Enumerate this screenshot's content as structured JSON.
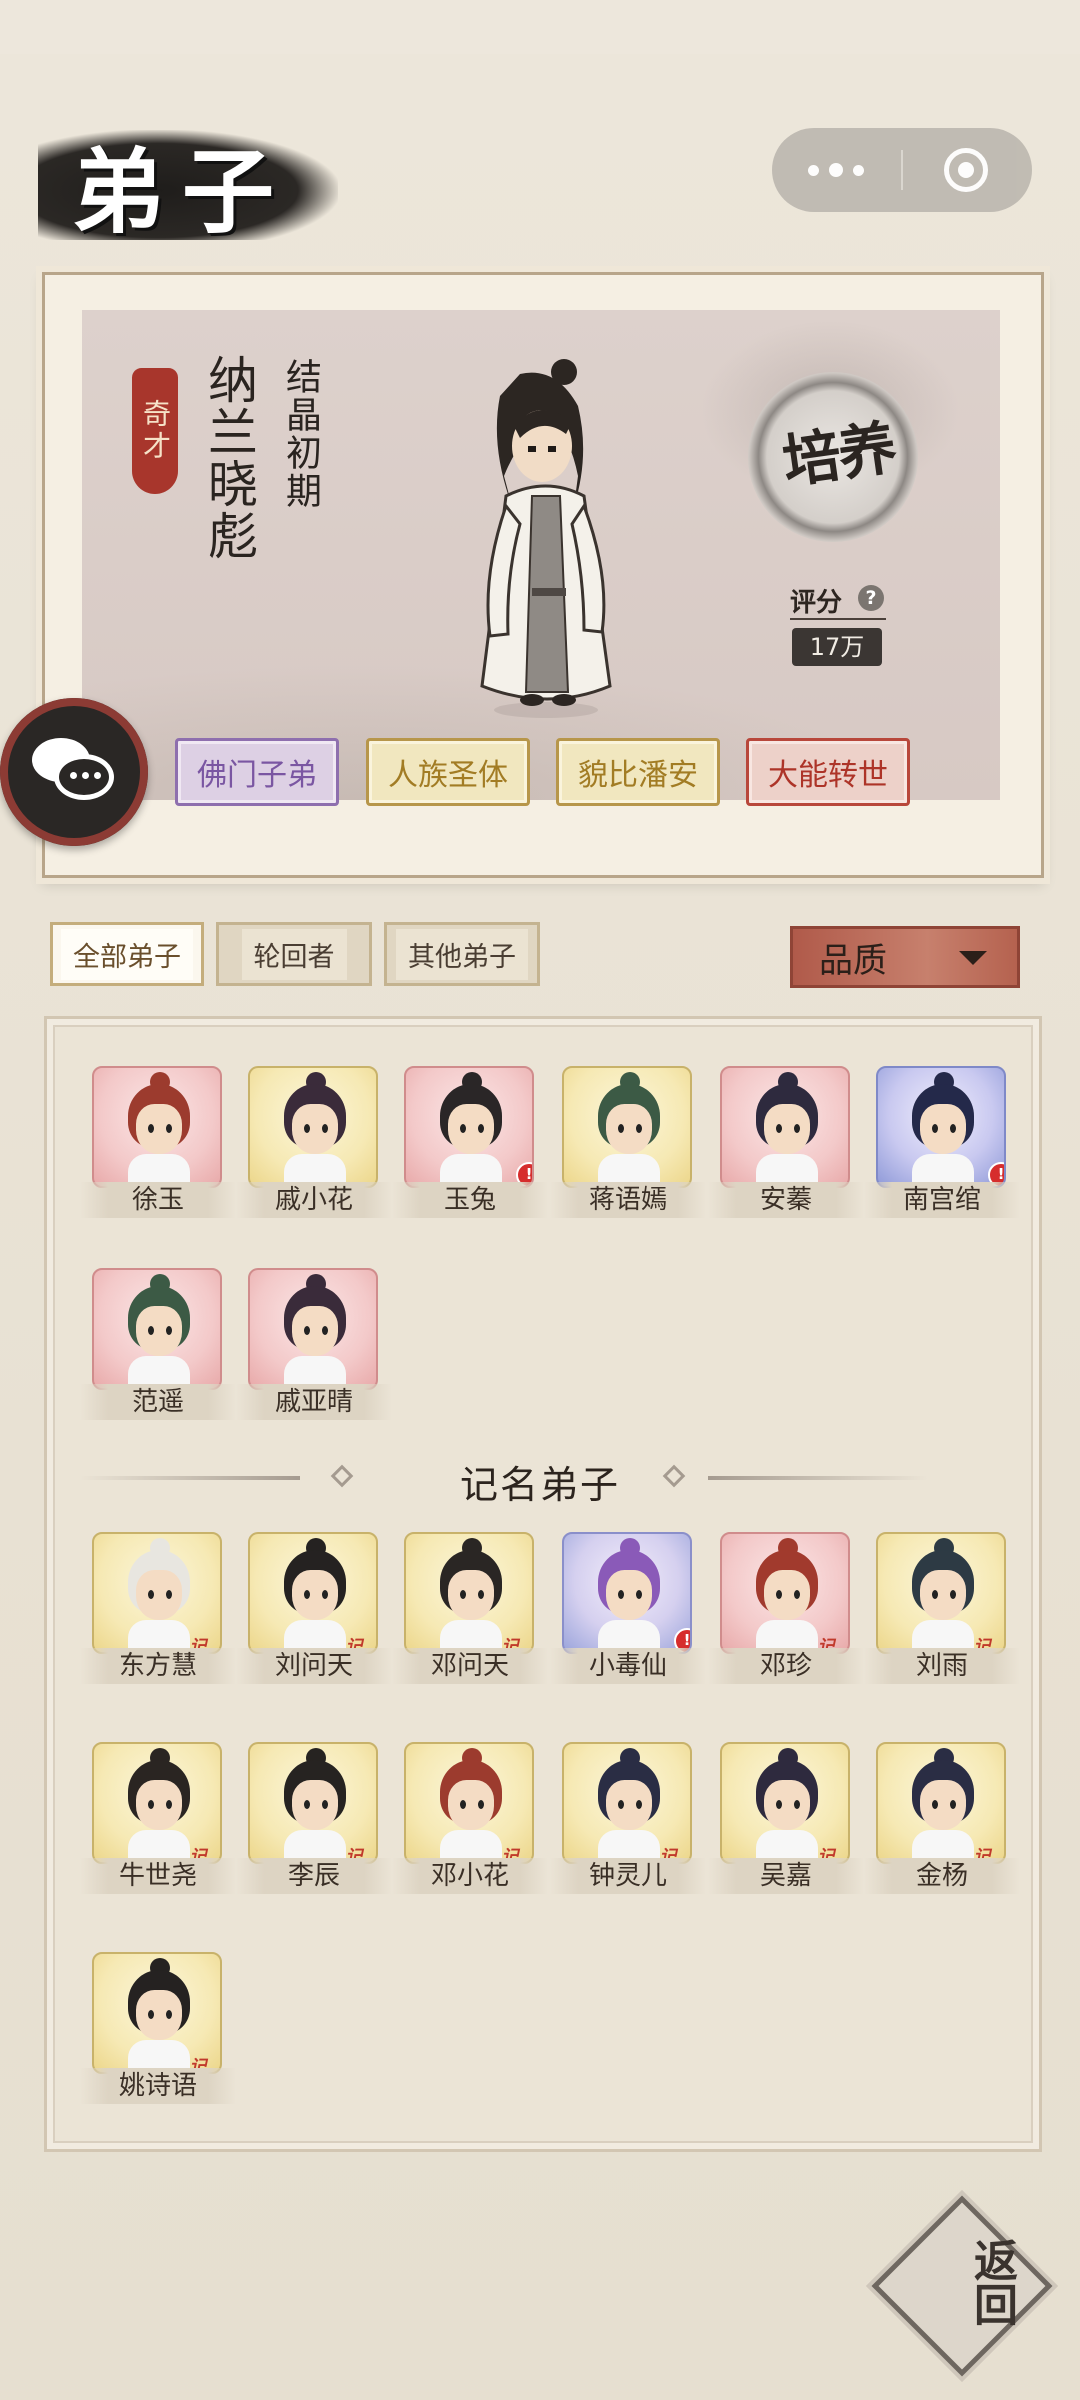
{
  "header": {
    "title": "弟子"
  },
  "hero": {
    "rank_tag": "奇才",
    "name": "纳兰晓彪",
    "realm": "结晶初期",
    "cultivate_label": "培养",
    "score_label": "评分",
    "score_help": "?",
    "score_value": "17万",
    "traits": [
      "佛门子弟",
      "人族圣体",
      "貌比潘安",
      "大能转世"
    ]
  },
  "filters": {
    "all": "全部弟子",
    "reincarnated": "轮回者",
    "others": "其他弟子",
    "quality": "品质"
  },
  "disciples": [
    {
      "name": "徐玉",
      "quality": "pink",
      "hair": "#9c3b2e",
      "alert": false
    },
    {
      "name": "戚小花",
      "quality": "gold",
      "hair": "#3a2b3a",
      "alert": false
    },
    {
      "name": "玉兔",
      "quality": "pink",
      "hair": "#2a2627",
      "alert": true
    },
    {
      "name": "蒋语嫣",
      "quality": "gold",
      "hair": "#3c5a45",
      "alert": false
    },
    {
      "name": "安蓁",
      "quality": "pink",
      "hair": "#2e2a3e",
      "alert": false
    },
    {
      "name": "南宫绾",
      "quality": "blue",
      "hair": "#24294a",
      "alert": true
    },
    {
      "name": "范遥",
      "quality": "pink",
      "hair": "#3c5a45",
      "alert": false
    },
    {
      "name": "戚亚晴",
      "quality": "pink",
      "hair": "#3a2b3a",
      "alert": false
    }
  ],
  "named_section_title": "记名弟子",
  "named_disciples": [
    {
      "name": "东方慧",
      "quality": "gold",
      "hair": "#e8e6e0",
      "alert": false
    },
    {
      "name": "刘问天",
      "quality": "gold",
      "hair": "#252221",
      "alert": false
    },
    {
      "name": "邓问天",
      "quality": "gold",
      "hair": "#2a2624",
      "alert": false
    },
    {
      "name": "小毒仙",
      "quality": "purple",
      "hair": "#8a5ab8",
      "alert": true
    },
    {
      "name": "邓珍",
      "quality": "pink",
      "hair": "#a13a2d",
      "alert": false
    },
    {
      "name": "刘雨",
      "quality": "gold",
      "hair": "#2d3a44",
      "alert": false
    },
    {
      "name": "牛世尧",
      "quality": "gold",
      "hair": "#2a2522",
      "alert": false
    },
    {
      "name": "李辰",
      "quality": "gold",
      "hair": "#262321",
      "alert": false
    },
    {
      "name": "邓小花",
      "quality": "gold",
      "hair": "#9c3b2e",
      "alert": false
    },
    {
      "name": "钟灵儿",
      "quality": "gold",
      "hair": "#2a2d44",
      "alert": false
    },
    {
      "name": "吴嘉",
      "quality": "gold",
      "hair": "#2e2a3e",
      "alert": false
    },
    {
      "name": "金杨",
      "quality": "gold",
      "hair": "#2a2d44",
      "alert": false
    },
    {
      "name": "姚诗语",
      "quality": "gold",
      "hair": "#252221",
      "alert": false
    }
  ],
  "named_seal": "记",
  "back_label": "返回"
}
